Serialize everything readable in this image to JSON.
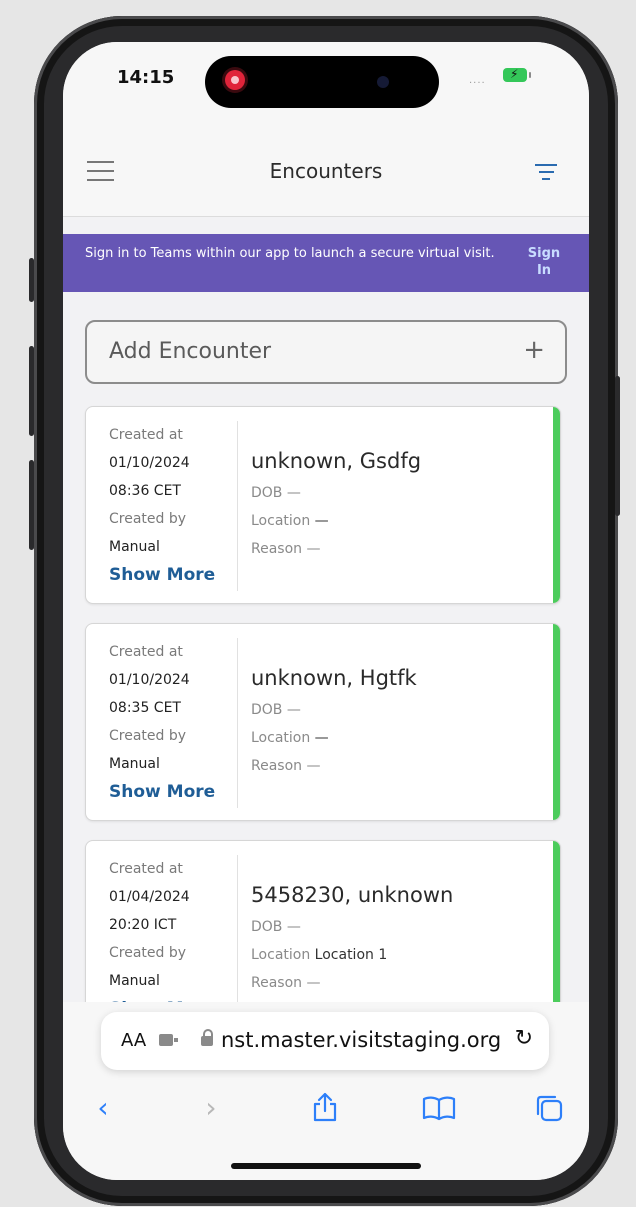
{
  "status_bar": {
    "time": "14:15",
    "signal": "....",
    "battery_color": "#34c759"
  },
  "app": {
    "title": "Encounters",
    "menu_icon": "hamburger-menu-icon",
    "filter_icon": "filter-icon"
  },
  "banner": {
    "text": "Sign in to Teams within our app to launch a secure virtual visit.",
    "link": "Sign In",
    "color": "#6656b5"
  },
  "add_encounter": {
    "label": "Add Encounter",
    "icon": "plus-icon"
  },
  "encounters": [
    {
      "created_at_label": "Created at",
      "date": "01/10/2024",
      "time": "08:36 CET",
      "created_by_label": "Created by",
      "created_by": "Manual",
      "show_more": "Show More",
      "name": "unknown, Gsdfg",
      "dob_label": "DOB",
      "dob": "—",
      "location_label": "Location",
      "location": "—",
      "reason_label": "Reason",
      "reason": "—"
    },
    {
      "created_at_label": "Created at",
      "date": "01/10/2024",
      "time": "08:35 CET",
      "created_by_label": "Created by",
      "created_by": "Manual",
      "show_more": "Show More",
      "name": "unknown, Hgtfk",
      "dob_label": "DOB",
      "dob": "—",
      "location_label": "Location",
      "location": "—",
      "reason_label": "Reason",
      "reason": "—"
    },
    {
      "created_at_label": "Created at",
      "date": "01/04/2024",
      "time": "20:20 ICT",
      "created_by_label": "Created by",
      "created_by": "Manual",
      "show_more": "Show More",
      "name": "5458230, unknown",
      "dob_label": "DOB",
      "dob": "—",
      "location_label": "Location",
      "location": "Location 1",
      "reason_label": "Reason",
      "reason": "—"
    }
  ],
  "browser": {
    "text_size_label": "AA",
    "url": "nst.master.visitstaging.org",
    "toolbar": [
      "back-icon",
      "forward-icon",
      "share-icon",
      "bookmarks-icon",
      "tabs-icon"
    ]
  },
  "accent_color": "#4ccc5c"
}
